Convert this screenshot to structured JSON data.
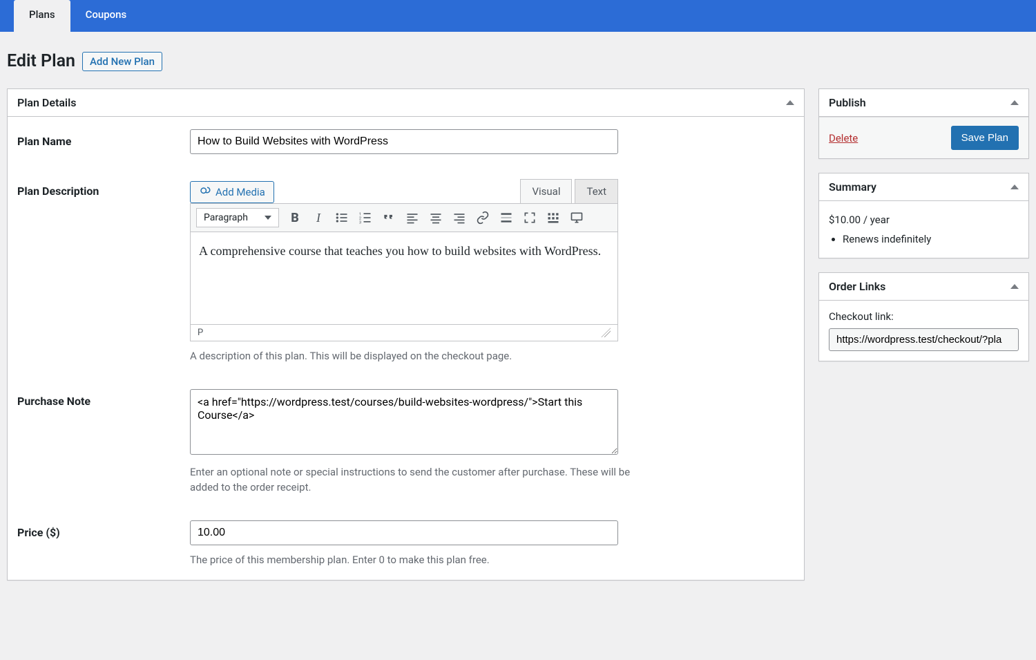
{
  "tabs": {
    "plans": "Plans",
    "coupons": "Coupons"
  },
  "heading": {
    "title": "Edit Plan",
    "add_new": "Add New Plan"
  },
  "planDetails": {
    "title": "Plan Details",
    "nameLabel": "Plan Name",
    "nameValue": "How to Build Websites with WordPress",
    "descLabel": "Plan Description",
    "addMedia": "Add Media",
    "visualTab": "Visual",
    "textTab": "Text",
    "formatSelect": "Paragraph",
    "descValue": "A comprehensive course that teaches you how to build websites with WordPress.",
    "statusPath": "P",
    "descHelp": "A description of this plan. This will be displayed on the checkout page.",
    "noteLabel": "Purchase Note",
    "noteValue": "<a href=\"https://wordpress.test/courses/build-websites-wordpress/\">Start this Course</a>",
    "noteHelp": "Enter an optional note or special instructions to send the customer after purchase. These will be added to the order receipt.",
    "priceLabel": "Price ($)",
    "priceValue": "10.00",
    "priceHelp": "The price of this membership plan. Enter 0 to make this plan free."
  },
  "publish": {
    "title": "Publish",
    "delete": "Delete",
    "save": "Save Plan"
  },
  "summary": {
    "title": "Summary",
    "price": "$10.00 / year",
    "item1": "Renews indefinitely"
  },
  "orderLinks": {
    "title": "Order Links",
    "label": "Checkout link:",
    "value": "https://wordpress.test/checkout/?pla"
  }
}
